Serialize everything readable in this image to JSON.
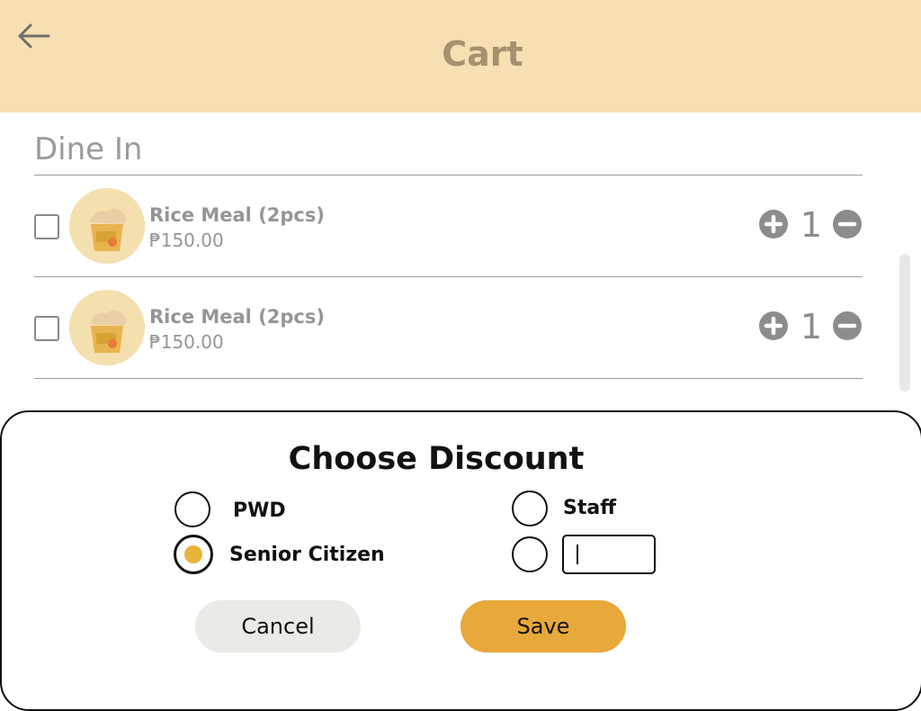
{
  "header": {
    "title": "Cart",
    "back_icon": "arrow-left-icon",
    "background": "#f5dfb3"
  },
  "section": {
    "title": "Dine In"
  },
  "cart": {
    "items": [
      {
        "name": "Rice Meal (2pcs)",
        "price": "₱150.00",
        "quantity": "1",
        "checked": false
      },
      {
        "name": "Rice Meal (2pcs)",
        "price": "₱150.00",
        "quantity": "1",
        "checked": false
      }
    ]
  },
  "discount": {
    "title": "Choose Discount",
    "options": [
      {
        "label": "PWD",
        "selected": false
      },
      {
        "label": "Staff",
        "selected": false
      },
      {
        "label": "Senior Citizen",
        "selected": true
      },
      {
        "label": "",
        "selected": false
      }
    ],
    "other_input": {
      "value": ""
    },
    "cancel_label": "Cancel",
    "save_label": "Save"
  },
  "colors": {
    "accent": "#e8a93a",
    "radio_selected": "#e8b43c",
    "cancel_button": "#eaeae6"
  }
}
